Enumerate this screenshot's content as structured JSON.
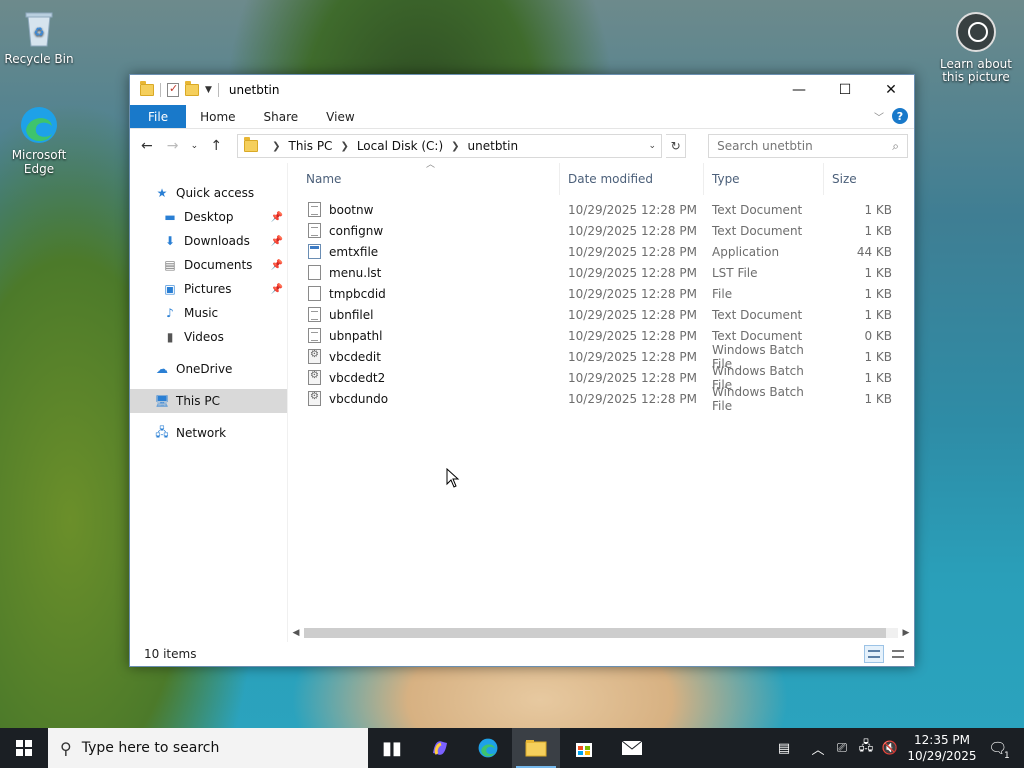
{
  "desktop": {
    "icons": [
      {
        "label": "Recycle Bin"
      },
      {
        "label": "Microsoft Edge"
      }
    ],
    "learn_label": "Learn about this picture"
  },
  "window": {
    "title": "unetbtin",
    "ribbon_tabs": [
      "File",
      "Home",
      "Share",
      "View"
    ],
    "breadcrumb": [
      "This PC",
      "Local Disk (C:)",
      "unetbtin"
    ],
    "search_placeholder": "Search unetbtin",
    "columns": {
      "name": "Name",
      "date": "Date modified",
      "type": "Type",
      "size": "Size"
    },
    "nav": {
      "quick_access": "Quick access",
      "desktop": "Desktop",
      "downloads": "Downloads",
      "documents": "Documents",
      "pictures": "Pictures",
      "music": "Music",
      "videos": "Videos",
      "onedrive": "OneDrive",
      "thispc": "This PC",
      "network": "Network"
    },
    "files": [
      {
        "name": "bootnw",
        "date": "10/29/2025 12:28 PM",
        "type": "Text Document",
        "size": "1 KB",
        "icon": "text-file-icon"
      },
      {
        "name": "confignw",
        "date": "10/29/2025 12:28 PM",
        "type": "Text Document",
        "size": "1 KB",
        "icon": "text-file-icon"
      },
      {
        "name": "emtxfile",
        "date": "10/29/2025 12:28 PM",
        "type": "Application",
        "size": "44 KB",
        "icon": "application-icon"
      },
      {
        "name": "menu.lst",
        "date": "10/29/2025 12:28 PM",
        "type": "LST File",
        "size": "1 KB",
        "icon": "file-icon"
      },
      {
        "name": "tmpbcdid",
        "date": "10/29/2025 12:28 PM",
        "type": "File",
        "size": "1 KB",
        "icon": "file-icon"
      },
      {
        "name": "ubnfilel",
        "date": "10/29/2025 12:28 PM",
        "type": "Text Document",
        "size": "1 KB",
        "icon": "text-file-icon"
      },
      {
        "name": "ubnpathl",
        "date": "10/29/2025 12:28 PM",
        "type": "Text Document",
        "size": "0 KB",
        "icon": "text-file-icon"
      },
      {
        "name": "vbcdedit",
        "date": "10/29/2025 12:28 PM",
        "type": "Windows Batch File",
        "size": "1 KB",
        "icon": "batch-file-icon"
      },
      {
        "name": "vbcdedt2",
        "date": "10/29/2025 12:28 PM",
        "type": "Windows Batch File",
        "size": "1 KB",
        "icon": "batch-file-icon"
      },
      {
        "name": "vbcdundo",
        "date": "10/29/2025 12:28 PM",
        "type": "Windows Batch File",
        "size": "1 KB",
        "icon": "batch-file-icon"
      }
    ],
    "status": "10 items"
  },
  "taskbar": {
    "search_placeholder": "Type here to search",
    "time": "12:35 PM",
    "date": "10/29/2025",
    "notification_count": "1"
  },
  "colors": {
    "ribbon_file_tab": "#1979ca",
    "taskbar": "#1b1f24",
    "selected_nav": "#d9d9d9"
  }
}
